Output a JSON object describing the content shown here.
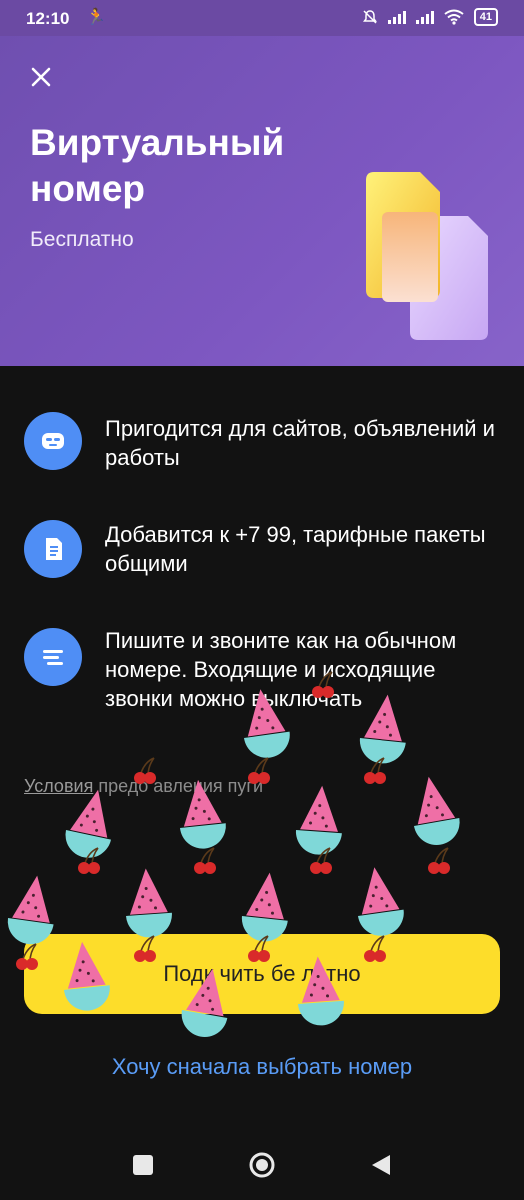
{
  "status_bar": {
    "time": "12:10",
    "battery": "41"
  },
  "hero": {
    "title": "Виртуальный номер",
    "subtitle": "Бесплатно",
    "background_color": "#7a55bd"
  },
  "features": [
    {
      "icon": "mask-icon",
      "text": "Пригодится для сайтов, объявлений и работы"
    },
    {
      "icon": "sim-card-icon",
      "text": "Добавится к +7 99, тарифные пакеты общими"
    },
    {
      "icon": "chat-lines-icon",
      "text": "Пишите и звоните как на обычном номере. Входящие и исходящие звонки можно выключать"
    }
  ],
  "terms": {
    "link_text": "Условия",
    "rest_text": "предо авления пуги"
  },
  "primary_button": {
    "label": "Подк чить бе латно",
    "color": "#fddd2a"
  },
  "secondary_link": {
    "label": "Хочу сначала выбрать номер",
    "color": "#5a9cf6"
  },
  "accent_color": "#4f8ef5"
}
